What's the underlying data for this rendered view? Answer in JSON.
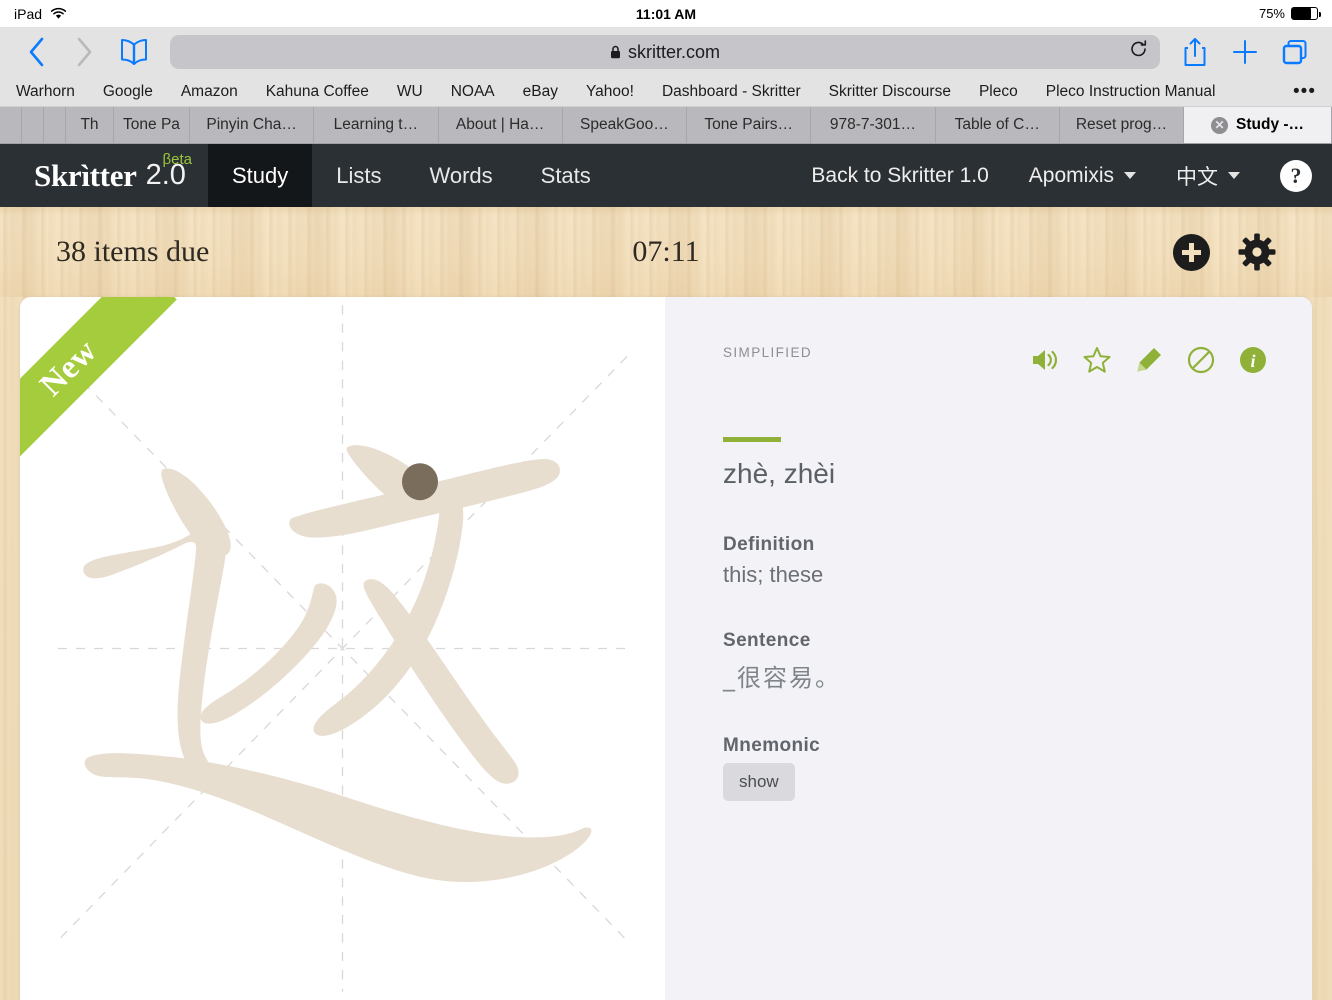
{
  "ios_status": {
    "device": "iPad",
    "wifi_icon": "wifi-icon",
    "clock": "11:01 AM",
    "battery_percent": "75%",
    "battery_level": 75
  },
  "safari": {
    "back_icon": "chevron-left-icon",
    "forward_icon": "chevron-right-icon",
    "bookmarks_icon": "book-icon",
    "url": "skritter.com",
    "lock_icon": "lock-icon",
    "reload_icon": "reload-icon",
    "share_icon": "share-icon",
    "newtab_icon": "plus-icon",
    "tabs_icon": "tabs-overview-icon",
    "bookmarks_bar": [
      "Warhorn",
      "Google",
      "Amazon",
      "Kahuna Coffee",
      "WU",
      "NOAA",
      "eBay",
      "Yahoo!",
      "Dashboard - Skritter",
      "Skritter Discourse",
      "Pleco",
      "Pleco Instruction Manual"
    ],
    "bookmarks_more": "•••",
    "tabs": [
      {
        "title": "",
        "width": "narrow",
        "active": false
      },
      {
        "title": "",
        "width": "narrow",
        "active": false
      },
      {
        "title": "",
        "width": "narrow",
        "active": false
      },
      {
        "title": "Th",
        "width": "small",
        "active": false
      },
      {
        "title": "Tone Pa",
        "width": "small2",
        "active": false
      },
      {
        "title": "Pinyin Cha…",
        "width": "",
        "active": false
      },
      {
        "title": "Learning t…",
        "width": "",
        "active": false
      },
      {
        "title": "About | Ha…",
        "width": "",
        "active": false
      },
      {
        "title": "SpeakGoo…",
        "width": "",
        "active": false
      },
      {
        "title": "Tone Pairs…",
        "width": "",
        "active": false
      },
      {
        "title": "978-7-301…",
        "width": "",
        "active": false
      },
      {
        "title": "Table of C…",
        "width": "",
        "active": false
      },
      {
        "title": "Reset prog…",
        "width": "",
        "active": false
      },
      {
        "title": "Study -…",
        "width": "",
        "active": true,
        "close_icon": "close-icon"
      }
    ]
  },
  "skritter_nav": {
    "brand_name": "Skrìtter",
    "brand_version": "2.0",
    "brand_beta": "βeta",
    "tabs": [
      {
        "label": "Study",
        "active": true
      },
      {
        "label": "Lists",
        "active": false
      },
      {
        "label": "Words",
        "active": false
      },
      {
        "label": "Stats",
        "active": false
      }
    ],
    "back_link": "Back to Skritter 1.0",
    "account": "Apomixis",
    "language": "中文",
    "help_label": "?",
    "accent_color": "#9ac43a",
    "bar_color": "#2b3034"
  },
  "study_header": {
    "items_due": "38 items due",
    "timer": "07:11",
    "add_icon": "plus-circle-icon",
    "settings_icon": "gear-icon"
  },
  "writing_pane": {
    "ribbon_label": "New",
    "ribbon_color": "#a5cc3c",
    "stroke_hint_color": "#e8ded0",
    "stroke_dot_color": "#7a6d5c",
    "character": "这",
    "grid_color": "#d6d6d6"
  },
  "info_pane": {
    "script_label": "SIMPLIFIED",
    "icons": [
      {
        "name": "audio-icon",
        "label": "audio"
      },
      {
        "name": "star-icon",
        "label": "star"
      },
      {
        "name": "pencil-icon",
        "label": "edit"
      },
      {
        "name": "ban-icon",
        "label": "ban"
      },
      {
        "name": "info-icon",
        "label": "info"
      }
    ],
    "icon_color": "#8fb137",
    "reading": "zhè, zhèi",
    "definition_heading": "Definition",
    "definition": "this; these",
    "sentence_heading": "Sentence",
    "sentence": "_很容易。",
    "mnemonic_heading": "Mnemonic",
    "mnemonic_button": "show",
    "background": "#f2f2f7"
  }
}
